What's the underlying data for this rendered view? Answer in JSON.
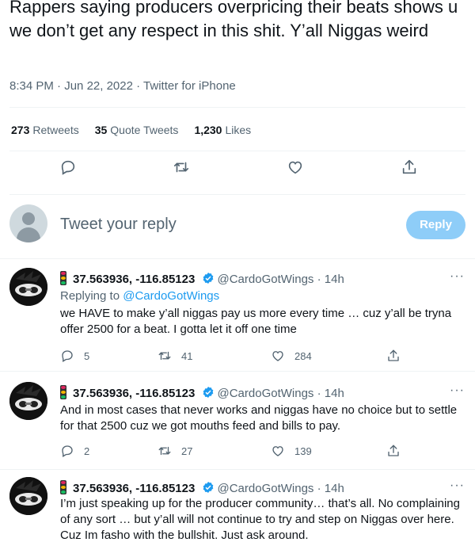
{
  "main_tweet": {
    "text": "Rappers saying producers overpricing their beats shows u we don’t get any respect in this shit. Y’all Niggas weird",
    "time": "8:34 PM",
    "date": "Jun 22, 2022",
    "source": "Twitter for iPhone",
    "sep": "·",
    "stats": {
      "retweets_count": "273",
      "retweets_label": "Retweets",
      "quotes_count": "35",
      "quotes_label": "Quote Tweets",
      "likes_count": "1,230",
      "likes_label": "Likes"
    }
  },
  "reply_box": {
    "placeholder": "Tweet your reply",
    "button": "Reply"
  },
  "replies": [
    {
      "name": "37.563936, -116.85123",
      "handle": "@CardoGotWings",
      "time": "14h",
      "replying_prefix": "Replying to",
      "replying_to": "@CardoGotWings",
      "text": "we HAVE to make y’all niggas pay us more every time … cuz y’all be tryna offer 2500 for a beat. I gotta let it off one time",
      "replies": "5",
      "retweets": "41",
      "likes": "284"
    },
    {
      "name": "37.563936, -116.85123",
      "handle": "@CardoGotWings",
      "time": "14h",
      "text": "And in most cases that never works and niggas have no choice but to settle for that 2500 cuz we got mouths feed and bills to pay.",
      "replies": "2",
      "retweets": "27",
      "likes": "139"
    },
    {
      "name": "37.563936, -116.85123",
      "handle": "@CardoGotWings",
      "time": "14h",
      "text": "I’m just speaking up for the producer community… that’s all. No complaining of any sort … but y’all will not continue to try and step on Niggas over here. Cuz Im fasho with the bullshit. Just ask around."
    }
  ],
  "more_label": "···",
  "colors": {
    "accent": "#1d9bf0",
    "muted": "#536471",
    "reply_button": "#8ecdf8"
  },
  "icons": [
    "reply-icon",
    "retweet-icon",
    "like-icon",
    "share-icon",
    "verified-badge-icon",
    "traffic-light-icon",
    "more-icon"
  ]
}
